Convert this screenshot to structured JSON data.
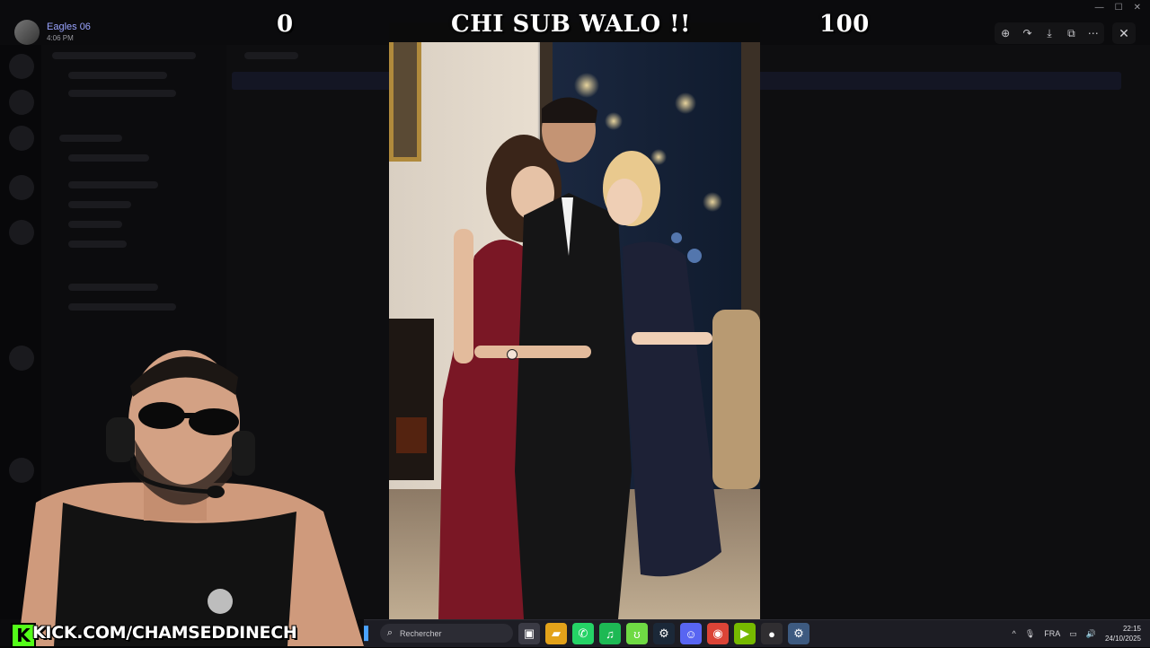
{
  "viewer": {
    "author_name": "Eagles 06",
    "author_time": "4:06 PM",
    "tools": [
      {
        "icon": "zoom-in-icon",
        "glyph": "⊕"
      },
      {
        "icon": "forward-icon",
        "glyph": "↷"
      },
      {
        "icon": "download-icon",
        "glyph": "⤓"
      },
      {
        "icon": "open-external-icon",
        "glyph": "⧉"
      },
      {
        "icon": "more-icon",
        "glyph": "⋯"
      }
    ],
    "close_glyph": "✕"
  },
  "meme": {
    "left_number": "0",
    "caption": "CHI SUB WALO !!",
    "right_number": "100"
  },
  "stream": {
    "kick_logo": "K",
    "kick_url": "KICK.COM/CHAMSEDDINECH"
  },
  "taskbar": {
    "search_placeholder": "Rechercher",
    "language": "FRA",
    "time": "22:15",
    "date": "24/10/2025",
    "apps": [
      {
        "name": "task-view-icon",
        "glyph": "▣",
        "color": "#3a3a44"
      },
      {
        "name": "file-explorer-icon",
        "glyph": "▰",
        "color": "#e3a21a"
      },
      {
        "name": "whatsapp-icon",
        "glyph": "✆",
        "color": "#25d366"
      },
      {
        "name": "spotify-icon",
        "glyph": "♫",
        "color": "#1db954"
      },
      {
        "name": "upwork-icon",
        "glyph": "ʊ",
        "color": "#6fda44"
      },
      {
        "name": "steam-icon",
        "glyph": "⚙",
        "color": "#1b2838"
      },
      {
        "name": "discord-icon",
        "glyph": "☺",
        "color": "#5865f2"
      },
      {
        "name": "chrome-icon",
        "glyph": "◉",
        "color": "#db4437"
      },
      {
        "name": "nvidia-icon",
        "glyph": "▶",
        "color": "#76b900"
      },
      {
        "name": "obs-icon",
        "glyph": "●",
        "color": "#302e31"
      },
      {
        "name": "settings-icon",
        "glyph": "⚙",
        "color": "#3d5a80"
      }
    ]
  },
  "colors": {
    "kick_green": "#53fc18",
    "author_name": "#9aa4ff"
  }
}
